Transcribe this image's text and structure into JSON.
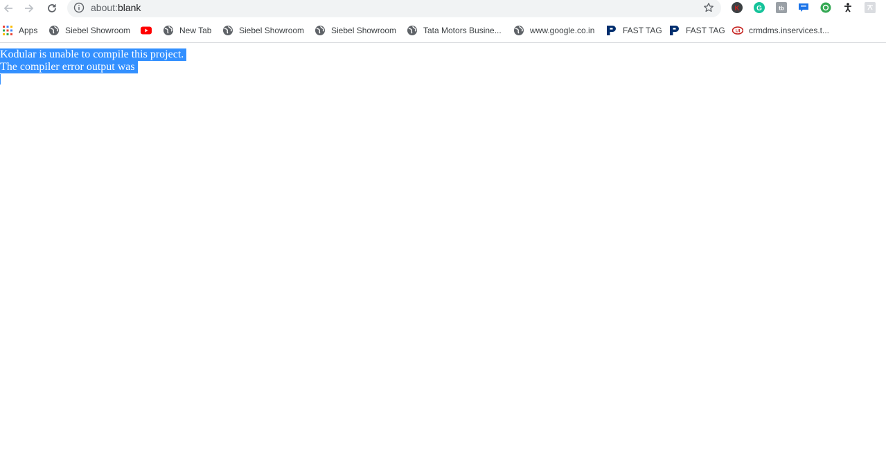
{
  "browser": {
    "omnibox": {
      "url_scheme": "about:",
      "url_path": "blank"
    },
    "nav": {
      "back_icon": "arrow-left-icon",
      "forward_icon": "arrow-right-icon",
      "reload_icon": "reload-icon"
    },
    "extensions": [
      {
        "icon": "k-circle-icon",
        "color": "#c5221f",
        "letter": "K"
      },
      {
        "icon": "grammarly-icon",
        "color": "#15c39a",
        "letter": "G"
      },
      {
        "icon": "tb-square-icon",
        "color": "#9aa0a6",
        "letter": "tb"
      },
      {
        "icon": "chat-bubble-icon",
        "color": "#1a73e8",
        "letter": ""
      },
      {
        "icon": "green-circle-icon",
        "color": "#34a853",
        "letter": ""
      },
      {
        "icon": "accessibility-icon",
        "color": "#202124",
        "letter": ""
      },
      {
        "icon": "translate-square-icon",
        "color": "#bdc1c6",
        "letter": ""
      }
    ]
  },
  "bookmarks": [
    {
      "label": "Apps",
      "icon": "apps-grid-icon"
    },
    {
      "label": "Siebel Showroom",
      "icon": "globe-icon"
    },
    {
      "label": "",
      "icon": "youtube-icon"
    },
    {
      "label": "New Tab",
      "icon": "globe-icon"
    },
    {
      "label": "Siebel Showroom",
      "icon": "globe-icon"
    },
    {
      "label": "Siebel Showroom",
      "icon": "globe-icon"
    },
    {
      "label": "Tata Motors Busine...",
      "icon": "globe-icon"
    },
    {
      "label": "www.google.co.in",
      "icon": "globe-icon"
    },
    {
      "label": "FAST TAG",
      "icon": "paytm-p-icon"
    },
    {
      "label": "FAST TAG",
      "icon": "paytm-p-icon"
    },
    {
      "label": "crmdms.inservices.t...",
      "icon": "ui-red-icon"
    }
  ],
  "page": {
    "line1": "Kodular is unable to compile this project.",
    "line2": "The compiler error output was"
  },
  "colors": {
    "selection": "#3390ff",
    "omnibox_bg": "#f1f3f4"
  }
}
